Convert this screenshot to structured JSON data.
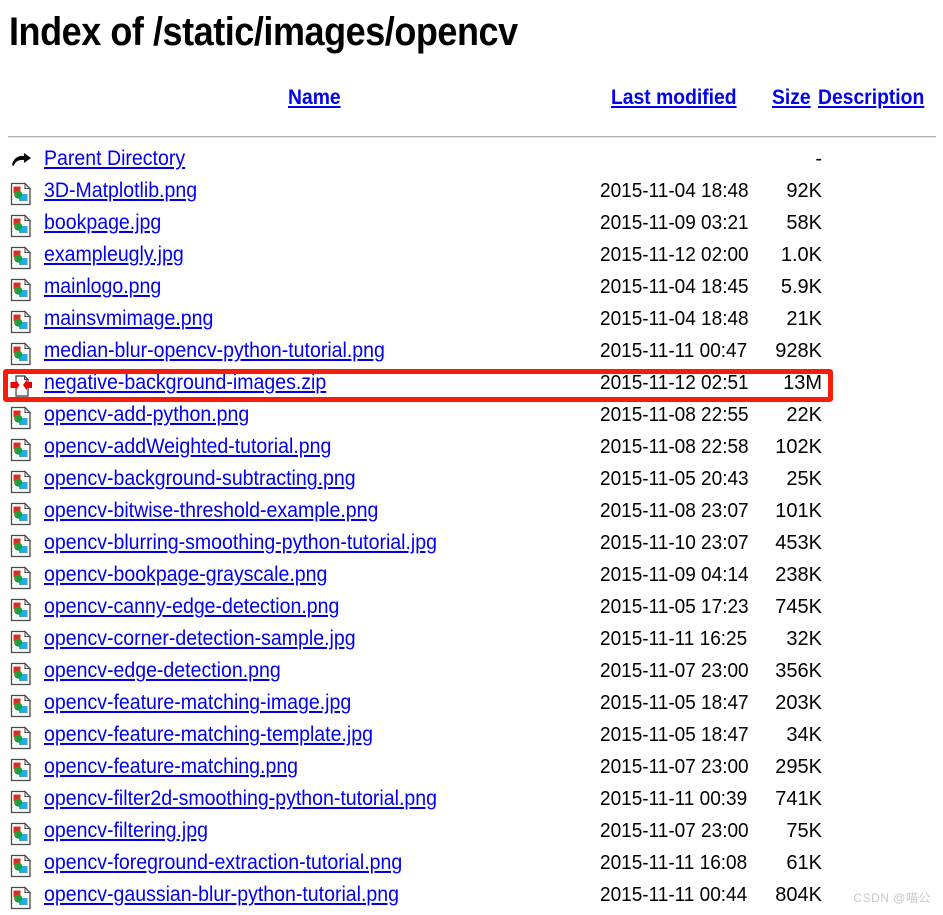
{
  "page": {
    "title": "Index of /static/images/opencv"
  },
  "columns": {
    "name": "Name",
    "last_modified": "Last modified",
    "size": "Size",
    "description": "Description"
  },
  "icons": {
    "parent_directory": "back-arrow-icon",
    "image": "image-file-icon",
    "compressed": "compressed-file-icon"
  },
  "highlight": {
    "color": "#F81D0A",
    "target_row_index": 7
  },
  "watermark": {
    "text": "CSDN @喵公"
  },
  "rows": [
    {
      "icon": "parent_directory",
      "name": "Parent Directory",
      "modified": "",
      "size": "-"
    },
    {
      "icon": "image",
      "name": "3D-Matplotlib.png",
      "modified": "2015-11-04 18:48",
      "size": "92K"
    },
    {
      "icon": "image",
      "name": "bookpage.jpg",
      "modified": "2015-11-09 03:21",
      "size": "58K"
    },
    {
      "icon": "image",
      "name": "exampleugly.jpg",
      "modified": "2015-11-12 02:00",
      "size": "1.0K"
    },
    {
      "icon": "image",
      "name": "mainlogo.png",
      "modified": "2015-11-04 18:45",
      "size": "5.9K"
    },
    {
      "icon": "image",
      "name": "mainsvmimage.png",
      "modified": "2015-11-04 18:48",
      "size": "21K"
    },
    {
      "icon": "image",
      "name": "median-blur-opencv-python-tutorial.png",
      "modified": "2015-11-11 00:47",
      "size": "928K"
    },
    {
      "icon": "compressed",
      "name": "negative-background-images.zip",
      "modified": "2015-11-12 02:51",
      "size": "13M"
    },
    {
      "icon": "image",
      "name": "opencv-add-python.png",
      "modified": "2015-11-08 22:55",
      "size": "22K"
    },
    {
      "icon": "image",
      "name": "opencv-addWeighted-tutorial.png",
      "modified": "2015-11-08 22:58",
      "size": "102K"
    },
    {
      "icon": "image",
      "name": "opencv-background-subtracting.png",
      "modified": "2015-11-05 20:43",
      "size": "25K"
    },
    {
      "icon": "image",
      "name": "opencv-bitwise-threshold-example.png",
      "modified": "2015-11-08 23:07",
      "size": "101K"
    },
    {
      "icon": "image",
      "name": "opencv-blurring-smoothing-python-tutorial.jpg",
      "modified": "2015-11-10 23:07",
      "size": "453K"
    },
    {
      "icon": "image",
      "name": "opencv-bookpage-grayscale.png",
      "modified": "2015-11-09 04:14",
      "size": "238K"
    },
    {
      "icon": "image",
      "name": "opencv-canny-edge-detection.png",
      "modified": "2015-11-05 17:23",
      "size": "745K"
    },
    {
      "icon": "image",
      "name": "opencv-corner-detection-sample.jpg",
      "modified": "2015-11-11 16:25",
      "size": "32K"
    },
    {
      "icon": "image",
      "name": "opencv-edge-detection.png",
      "modified": "2015-11-07 23:00",
      "size": "356K"
    },
    {
      "icon": "image",
      "name": "opencv-feature-matching-image.jpg",
      "modified": "2015-11-05 18:47",
      "size": "203K"
    },
    {
      "icon": "image",
      "name": "opencv-feature-matching-template.jpg",
      "modified": "2015-11-05 18:47",
      "size": "34K"
    },
    {
      "icon": "image",
      "name": "opencv-feature-matching.png",
      "modified": "2015-11-07 23:00",
      "size": "295K"
    },
    {
      "icon": "image",
      "name": "opencv-filter2d-smoothing-python-tutorial.png",
      "modified": "2015-11-11 00:39",
      "size": "741K"
    },
    {
      "icon": "image",
      "name": "opencv-filtering.jpg",
      "modified": "2015-11-07 23:00",
      "size": "75K"
    },
    {
      "icon": "image",
      "name": "opencv-foreground-extraction-tutorial.png",
      "modified": "2015-11-11 16:08",
      "size": "61K"
    },
    {
      "icon": "image",
      "name": "opencv-gaussian-blur-python-tutorial.png",
      "modified": "2015-11-11 00:44",
      "size": "804K"
    }
  ]
}
